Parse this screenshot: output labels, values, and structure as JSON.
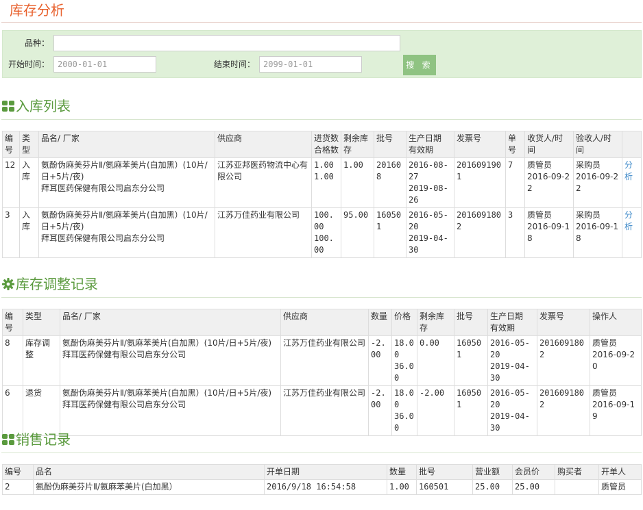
{
  "page": {
    "title": "库存分析"
  },
  "search": {
    "variety_label": "品种：",
    "variety_value": "",
    "start_label": "开始时间：",
    "start_value": "2000-01-01",
    "end_label": "结束时间：",
    "end_value": "2099-01-01",
    "button_label": "搜 索"
  },
  "colors": {
    "accent": "#5a9a3e",
    "title": "#e8602c",
    "panel": "#dff0d8",
    "button": "#8fc382",
    "link": "#3a87c8"
  },
  "inbound": {
    "title": "入库列表",
    "icon": "grid-icon",
    "headers": [
      "编号",
      "类型",
      "品名/ 厂家",
      "供应商",
      "进货数\n合格数",
      "剩余库存",
      "批号",
      "生产日期\n有效期",
      "发票号",
      "单号",
      "收货人/时间",
      "验收人/时间",
      ""
    ],
    "rows": [
      {
        "id": "12",
        "type": "入库",
        "name": "氨酚伪麻美芬片Ⅱ/氨麻苯美片(白加黑）(10片/日+5片/夜)\n拜耳医药保健有限公司启东分公司",
        "supplier": "江苏亚邦医药物流中心有限公司",
        "qty": "1.00\n1.00",
        "remain": "1.00",
        "batch": "201608",
        "dates": "2016-08-27\n2019-08-26",
        "invoice": "2016091901",
        "order": "7",
        "receiver": "质管员\n2016-09-22",
        "checker": "采购员\n2016-09-22",
        "action": "分析"
      },
      {
        "id": "3",
        "type": "入库",
        "name": "氨酚伪麻美芬片Ⅱ/氨麻苯美片(白加黑）(10片/日+5片/夜)\n拜耳医药保健有限公司启东分公司",
        "supplier": "江苏万佳药业有限公司",
        "qty": "100.00\n100.00",
        "remain": "95.00",
        "batch": "160501",
        "dates": "2016-05-20\n2019-04-30",
        "invoice": "2016091802",
        "order": "3",
        "receiver": "质管员\n2016-09-18",
        "checker": "采购员\n2016-09-18",
        "action": "分析"
      }
    ]
  },
  "adjust": {
    "title": "库存调整记录",
    "icon": "gear-icon",
    "headers": [
      "编号",
      "类型",
      "品名/ 厂家",
      "供应商",
      "数量",
      "价格",
      "剩余库存",
      "批号",
      "生产日期\n有效期",
      "发票号",
      "操作人"
    ],
    "rows": [
      {
        "id": "8",
        "type": "库存调整",
        "name": "氨酚伪麻美芬片Ⅱ/氨麻苯美片(白加黑）(10片/日+5片/夜)\n拜耳医药保健有限公司启东分公司",
        "supplier": "江苏万佳药业有限公司",
        "qty": "-2.00",
        "price": "18.00\n36.00",
        "remain": "0.00",
        "batch": "160501",
        "dates": "2016-05-20\n2019-04-30",
        "invoice": "2016091802",
        "operator": "质管员\n2016-09-20"
      },
      {
        "id": "6",
        "type": "退货",
        "name": "氨酚伪麻美芬片Ⅱ/氨麻苯美片(白加黑）(10片/日+5片/夜)\n拜耳医药保健有限公司启东分公司",
        "supplier": "江苏万佳药业有限公司",
        "qty": "-2.00",
        "price": "18.00\n36.00",
        "remain": "-2.00",
        "batch": "160501",
        "dates": "2016-05-20\n2019-04-30",
        "invoice": "2016091802",
        "operator": "质管员\n2016-09-19"
      }
    ]
  },
  "sales": {
    "title": "销售记录",
    "icon": "grid-icon",
    "headers": [
      "编号",
      "品名",
      "开单日期",
      "数量",
      "批号",
      "营业额",
      "会员价",
      "购买者",
      "开单人"
    ],
    "rows": [
      {
        "id": "2",
        "name": "氨酚伪麻美芬片Ⅱ/氨麻苯美片(白加黑）",
        "date": "2016/9/18 16:54:58",
        "qty": "1.00",
        "batch": "160501",
        "revenue": "25.00",
        "member_price": "25.00",
        "buyer": "",
        "seller": "质管员"
      }
    ]
  }
}
